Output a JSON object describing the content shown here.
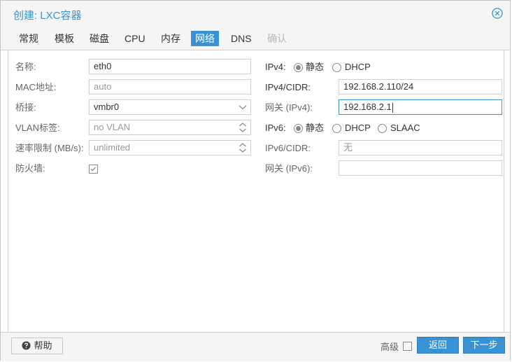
{
  "window": {
    "title": "创建: LXC容器"
  },
  "tabs": [
    {
      "label": "常规"
    },
    {
      "label": "模板"
    },
    {
      "label": "磁盘"
    },
    {
      "label": "CPU"
    },
    {
      "label": "内存"
    },
    {
      "label": "网络"
    },
    {
      "label": "DNS"
    },
    {
      "label": "确认"
    }
  ],
  "active_tab": "网络",
  "left": {
    "name_label": "名称:",
    "name_value": "eth0",
    "mac_label": "MAC地址:",
    "mac_placeholder": "auto",
    "bridge_label": "桥接:",
    "bridge_value": "vmbr0",
    "vlan_label": "VLAN标签:",
    "vlan_placeholder": "no VLAN",
    "rate_label": "速率限制 (MB/s):",
    "rate_placeholder": "unlimited",
    "firewall_label": "防火墙:",
    "firewall_checked": true
  },
  "right": {
    "ipv4_label": "IPv4:",
    "ipv4_static": "静态",
    "ipv4_dhcp": "DHCP",
    "ipv4_mode": "静态",
    "ipv4_cidr_label": "IPv4/CIDR:",
    "ipv4_cidr_value": "192.168.2.110/24",
    "gw4_label": "网关 (IPv4):",
    "gw4_value": "192.168.2.1",
    "ipv6_label": "IPv6:",
    "ipv6_static": "静态",
    "ipv6_dhcp": "DHCP",
    "ipv6_slaac": "SLAAC",
    "ipv6_mode": "静态",
    "ipv6_cidr_label": "IPv6/CIDR:",
    "ipv6_cidr_placeholder": "无",
    "gw6_label": "网关 (IPv6):",
    "gw6_value": ""
  },
  "footer": {
    "help_label": "帮助",
    "advanced_label": "高级",
    "advanced_checked": false,
    "back_label": "返回",
    "next_label": "下一步"
  },
  "colors": {
    "accent": "#3892d4",
    "disabled": "#b8b8b8"
  },
  "icons": {
    "close": "close-circle-icon",
    "help": "question-circle-icon",
    "dropdown": "chevron-down-icon",
    "spinner": "spinner-arrows-icon",
    "check": "checkmark-icon"
  }
}
